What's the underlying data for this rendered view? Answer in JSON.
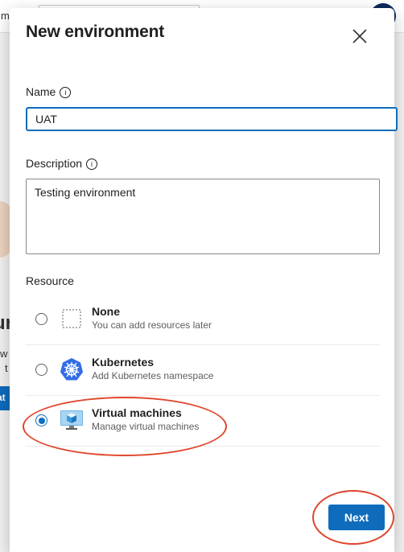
{
  "dialog": {
    "title": "New environment",
    "close_label": "Close"
  },
  "name": {
    "label": "Name",
    "value": "UAT"
  },
  "description": {
    "label": "Description",
    "value": "Testing environment"
  },
  "resource": {
    "label": "Resource",
    "options": [
      {
        "title": "None",
        "subtitle": "You can add resources later",
        "selected": false,
        "icon": "dashed-box-icon"
      },
      {
        "title": "Kubernetes",
        "subtitle": "Add Kubernetes namespace",
        "selected": false,
        "icon": "kubernetes-icon"
      },
      {
        "title": "Virtual machines",
        "subtitle": "Manage virtual machines",
        "selected": true,
        "icon": "virtual-machine-icon"
      }
    ]
  },
  "footer": {
    "next_label": "Next"
  },
  "background": {
    "header_fragment": "m",
    "big_fragment": "ur",
    "small_fragment_1": "w",
    "small_fragment_2": "t",
    "button_fragment": "at"
  },
  "colors": {
    "accent": "#0f6cbd",
    "highlight_ring": "#e0442b"
  }
}
